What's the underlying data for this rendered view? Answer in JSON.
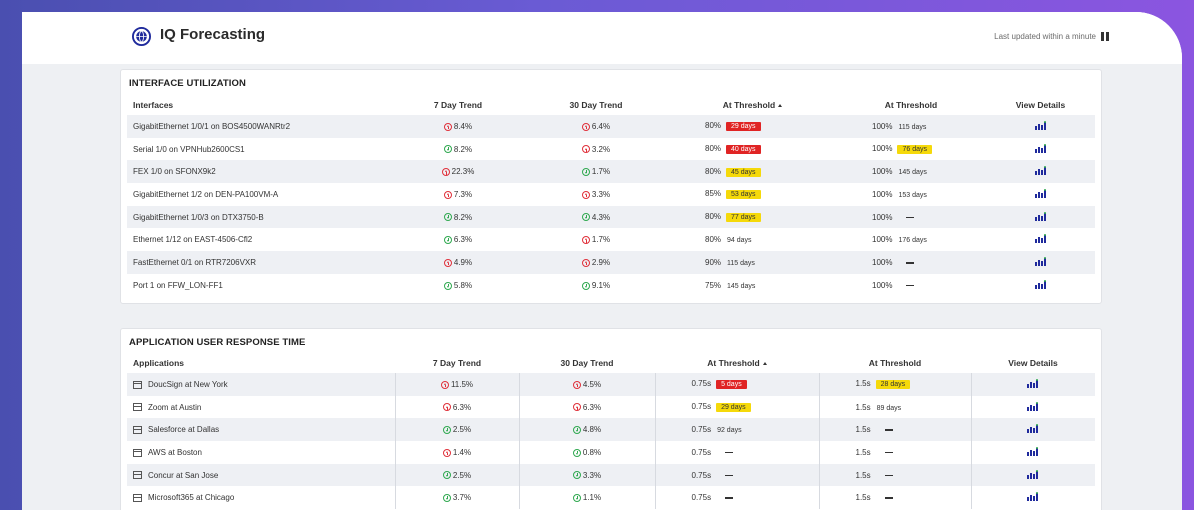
{
  "header": {
    "title": "IQ Forecasting",
    "last_updated": "Last updated within a minute"
  },
  "interface_panel": {
    "title": "INTERFACE UTILIZATION",
    "columns": [
      "Interfaces",
      "7 Day Trend",
      "30 Day Trend",
      "At Threshold",
      "At Threshold",
      "View Details"
    ],
    "rows": [
      {
        "name": "GigabitEthernet 1/0/1 on BOS4500WANRtr2",
        "t7": "8.4%",
        "t7dir": "up",
        "t30": "6.4%",
        "t30dir": "up",
        "thr1": "80%",
        "thr1_days": "29 days",
        "thr1_tag": "red",
        "thr2": "100%",
        "thr2_days": "115 days",
        "thr2_tag": "none"
      },
      {
        "name": "Serial 1/0 on VPNHub2600CS1",
        "t7": "8.2%",
        "t7dir": "down",
        "t30": "3.2%",
        "t30dir": "up",
        "thr1": "80%",
        "thr1_days": "40 days",
        "thr1_tag": "red",
        "thr2": "100%",
        "thr2_days": "76 days",
        "thr2_tag": "yellow"
      },
      {
        "name": "FEX 1/0 on SFONX9k2",
        "t7": "22.3%",
        "t7dir": "up",
        "t30": "1.7%",
        "t30dir": "down",
        "thr1": "80%",
        "thr1_days": "45 days",
        "thr1_tag": "yellow",
        "thr2": "100%",
        "thr2_days": "145 days",
        "thr2_tag": "none"
      },
      {
        "name": "GigabitEthernet 1/2 on DEN-PA100VM-A",
        "t7": "7.3%",
        "t7dir": "up",
        "t30": "3.3%",
        "t30dir": "up",
        "thr1": "85%",
        "thr1_days": "53 days",
        "thr1_tag": "yellow",
        "thr2": "100%",
        "thr2_days": "153 days",
        "thr2_tag": "none"
      },
      {
        "name": "GigabitEthernet 1/0/3 on DTX3750-B",
        "t7": "8.2%",
        "t7dir": "down",
        "t30": "4.3%",
        "t30dir": "down",
        "thr1": "80%",
        "thr1_days": "77 days",
        "thr1_tag": "yellow",
        "thr2": "100%",
        "thr2_days": "",
        "thr2_tag": "dash"
      },
      {
        "name": "Ethernet 1/12 on EAST-4506-Cfl2",
        "t7": "6.3%",
        "t7dir": "down",
        "t30": "1.7%",
        "t30dir": "up",
        "thr1": "80%",
        "thr1_days": "94 days",
        "thr1_tag": "none",
        "thr2": "100%",
        "thr2_days": "176 days",
        "thr2_tag": "none"
      },
      {
        "name": "FastEthernet 0/1 on RTR7206VXR",
        "t7": "4.9%",
        "t7dir": "up",
        "t30": "2.9%",
        "t30dir": "up",
        "thr1": "90%",
        "thr1_days": "115 days",
        "thr1_tag": "none",
        "thr2": "100%",
        "thr2_days": "",
        "thr2_tag": "dash"
      },
      {
        "name": "Port 1 on FFW_LON-FF1",
        "t7": "5.8%",
        "t7dir": "down",
        "t30": "9.1%",
        "t30dir": "down",
        "thr1": "75%",
        "thr1_days": "145 days",
        "thr1_tag": "none",
        "thr2": "100%",
        "thr2_days": "",
        "thr2_tag": "dash"
      }
    ]
  },
  "app_panel": {
    "title": "APPLICATION USER RESPONSE TIME",
    "columns": [
      "Applications",
      "7 Day Trend",
      "30 Day Trend",
      "At Threshold",
      "At Threshold",
      "View Details"
    ],
    "rows": [
      {
        "name": "DoucSign at New York",
        "t7": "11.5%",
        "t7dir": "up",
        "t30": "4.5%",
        "t30dir": "up",
        "thr1": "0.75s",
        "thr1_days": "5 days",
        "thr1_tag": "red",
        "thr2": "1.5s",
        "thr2_days": "28 days",
        "thr2_tag": "yellow"
      },
      {
        "name": "Zoom at Austin",
        "t7": "6.3%",
        "t7dir": "up",
        "t30": "6.3%",
        "t30dir": "up",
        "thr1": "0.75s",
        "thr1_days": "29 days",
        "thr1_tag": "yellow",
        "thr2": "1.5s",
        "thr2_days": "89 days",
        "thr2_tag": "none"
      },
      {
        "name": "Salesforce at Dallas",
        "t7": "2.5%",
        "t7dir": "down",
        "t30": "4.8%",
        "t30dir": "down",
        "thr1": "0.75s",
        "thr1_days": "92 days",
        "thr1_tag": "none",
        "thr2": "1.5s",
        "thr2_days": "",
        "thr2_tag": "dash"
      },
      {
        "name": "AWS at Boston",
        "t7": "1.4%",
        "t7dir": "up",
        "t30": "0.8%",
        "t30dir": "down",
        "thr1": "0.75s",
        "thr1_days": "",
        "thr1_tag": "dash",
        "thr2": "1.5s",
        "thr2_days": "",
        "thr2_tag": "dash"
      },
      {
        "name": "Concur at San Jose",
        "t7": "2.5%",
        "t7dir": "down",
        "t30": "3.3%",
        "t30dir": "down",
        "thr1": "0.75s",
        "thr1_days": "",
        "thr1_tag": "dash",
        "thr2": "1.5s",
        "thr2_days": "",
        "thr2_tag": "dash"
      },
      {
        "name": "Microsoft365 at Chicago",
        "t7": "3.7%",
        "t7dir": "down",
        "t30": "1.1%",
        "t30dir": "down",
        "thr1": "0.75s",
        "thr1_days": "",
        "thr1_tag": "dash",
        "thr2": "1.5s",
        "thr2_days": "",
        "thr2_tag": "dash"
      }
    ]
  },
  "colors": {
    "accent_blue": "#1f2a9c",
    "trend_up": "#e0303a",
    "trend_down": "#2fa84f",
    "tag_red": "#e02424",
    "tag_yellow": "#f5d90a"
  }
}
